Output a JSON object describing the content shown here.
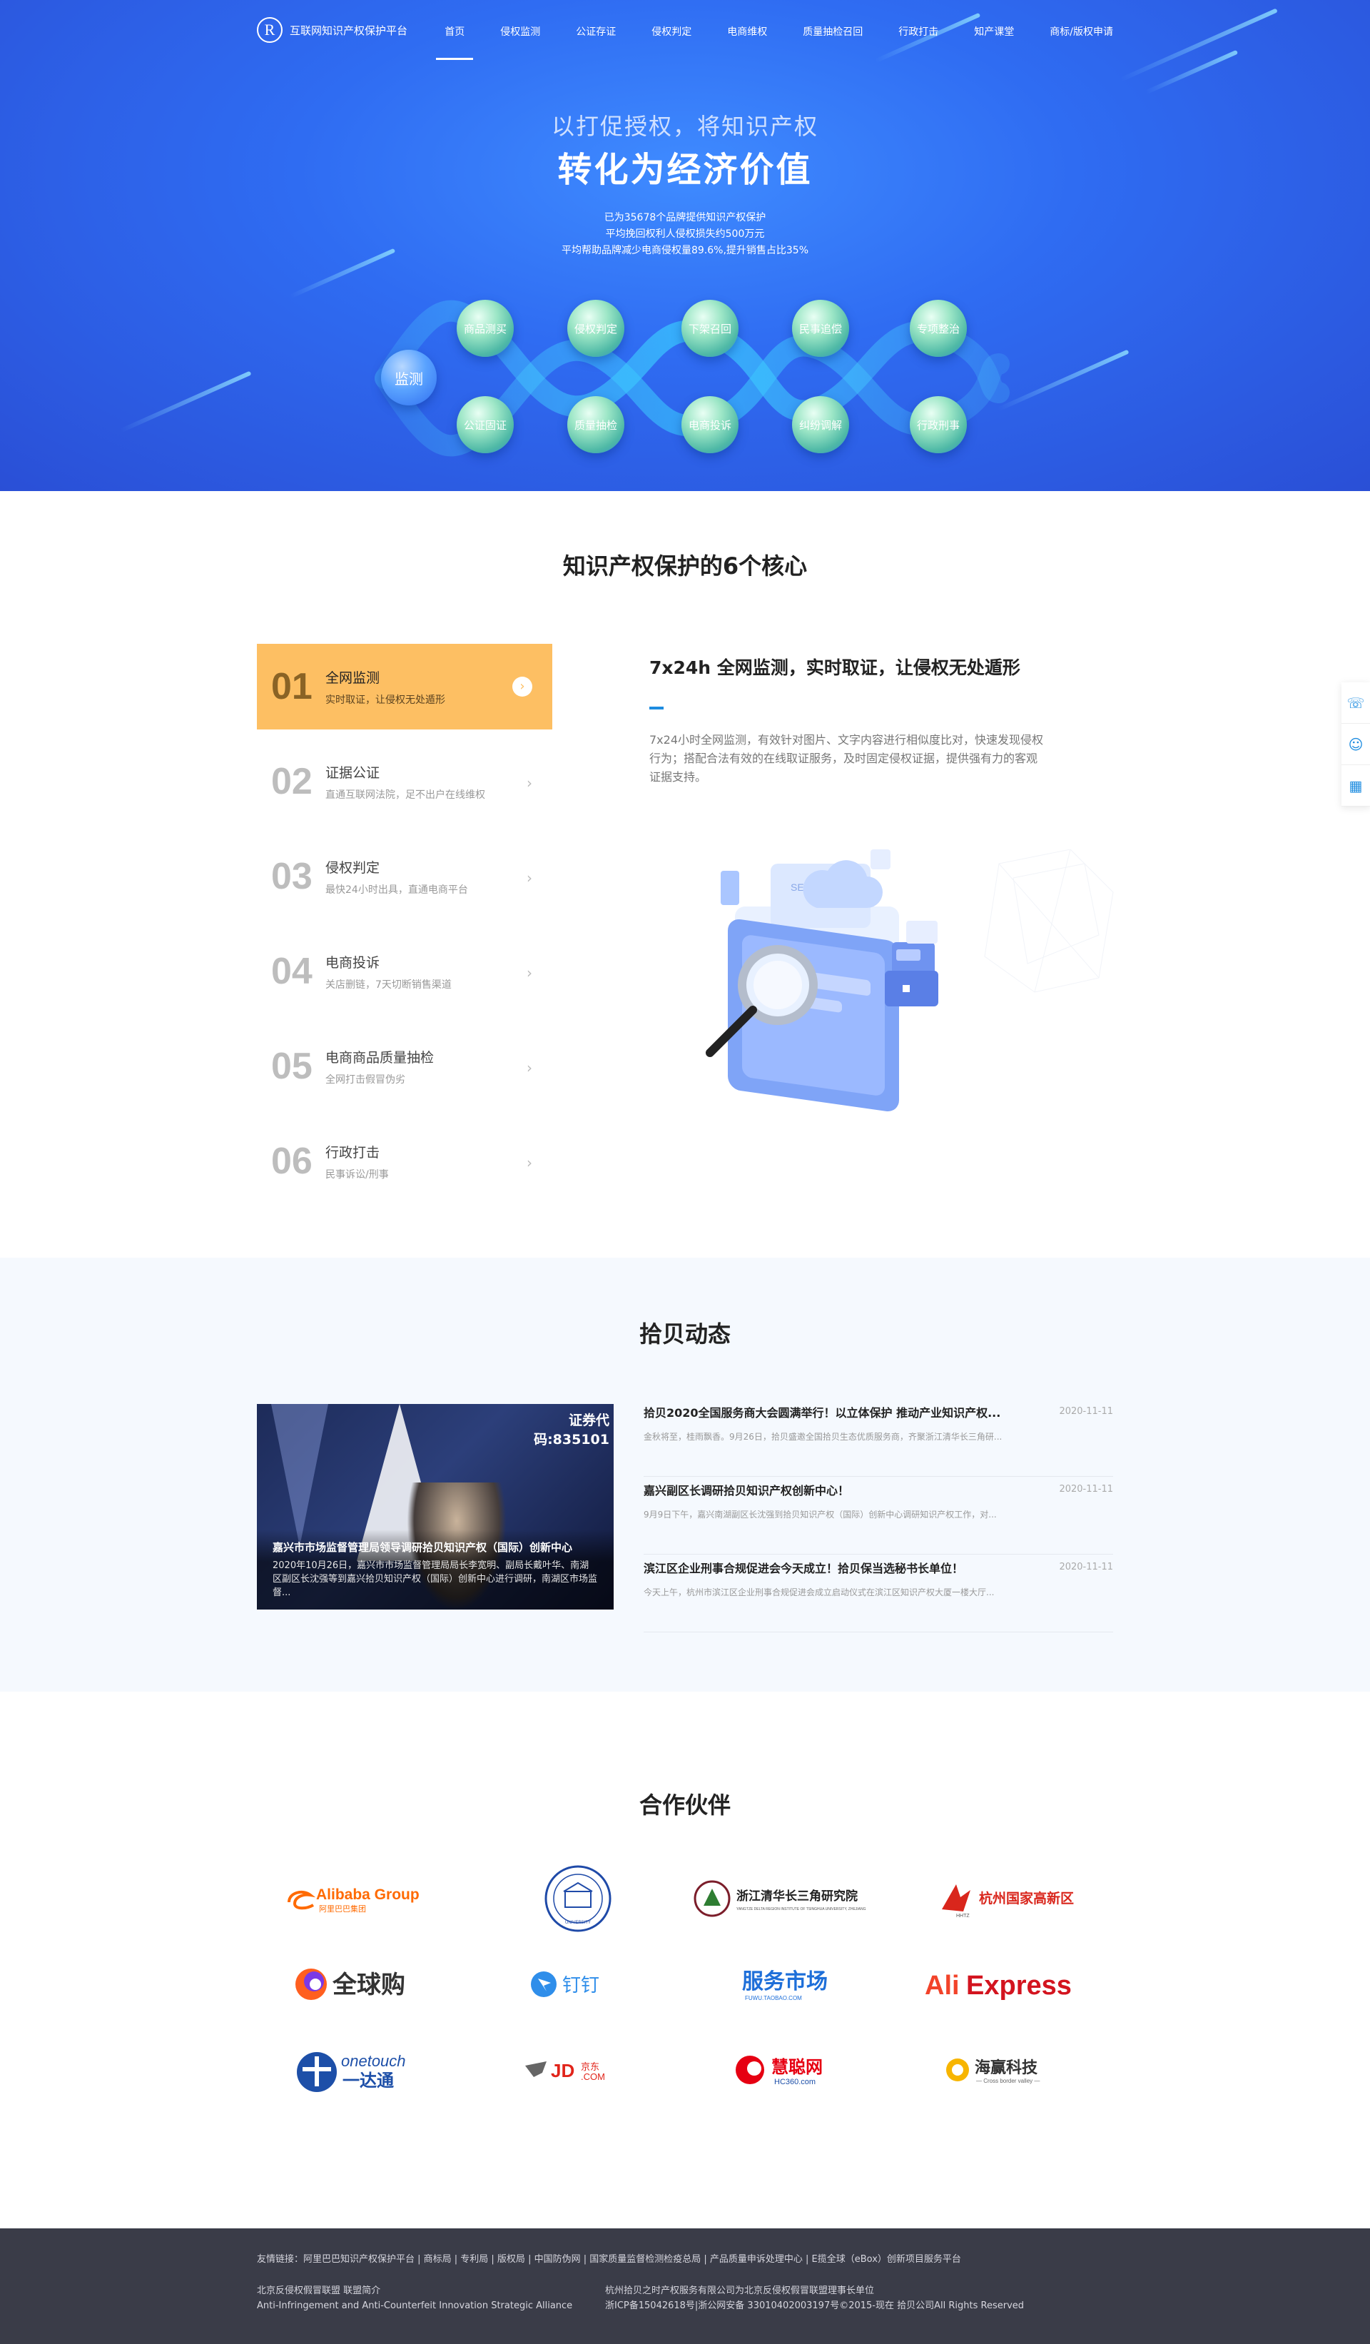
{
  "nav": {
    "logo_letter": "R",
    "logo_text": "互联网知识产权保护平台",
    "items": [
      "首页",
      "侵权监测",
      "公证存证",
      "侵权判定",
      "电商维权",
      "质量抽检召回",
      "行政打击",
      "知产课堂",
      "商标/版权申请"
    ]
  },
  "hero": {
    "subtitle": "以打促授权，将知识产权",
    "title": "转化为经济价值",
    "stats": [
      "已为35678个品牌提供知识产权保护",
      "平均挽回权利人侵权损失约500万元",
      "平均帮助品牌减少电商侵权量89.6%,提升销售占比35%"
    ],
    "center_label": "监测",
    "top_labels": [
      "商品测买",
      "侵权判定",
      "下架召回",
      "民事追偿",
      "专项整治"
    ],
    "bottom_labels": [
      "公证固证",
      "质量抽检",
      "电商投诉",
      "纠纷调解",
      "行政刑事"
    ]
  },
  "core": {
    "title": "知识产权保护的6个核心",
    "items": [
      {
        "num": "01",
        "title": "全网监测",
        "desc": "实时取证，让侵权无处遁形"
      },
      {
        "num": "02",
        "title": "证据公证",
        "desc": "直通互联网法院，足不出户在线维权"
      },
      {
        "num": "03",
        "title": "侵权判定",
        "desc": "最快24小时出具，直通电商平台"
      },
      {
        "num": "04",
        "title": "电商投诉",
        "desc": "关店删链，7天切断销售渠道"
      },
      {
        "num": "05",
        "title": "电商商品质量抽检",
        "desc": "全网打击假冒伪劣"
      },
      {
        "num": "06",
        "title": "行政打击",
        "desc": "民事诉讼/刑事"
      }
    ],
    "detail_title": "7x24h 全网监测，实时取证，让侵权无处遁形",
    "detail_text": "7x24小时全网监测，有效针对图片、文字内容进行相似度比对，快速发现侵权行为；搭配合法有效的在线取证服务，及时固定侵权证据，提供强有力的客观证据支持。",
    "illustration_label": "SEARCHING"
  },
  "news": {
    "title": "拾贝动态",
    "featured_title": "嘉兴市市场监督管理局领导调研拾贝知识产权（国际）创新中心",
    "featured_desc": "2020年10月26日，嘉兴市市场监督管理局局长李宽明、副局长戴叶华、南湖区副区长沈强等到嘉兴拾贝知识产权（国际）创新中心进行调研，南湖区市场监督...",
    "featured_bg_text": "证券代码:835101",
    "items": [
      {
        "title": "拾贝2020全国服务商大会圆满举行！以立体保护 推动产业知识产权...",
        "desc": "金秋将至，桂雨飘香。9月26日，拾贝盛邀全国拾贝生态优质服务商，齐聚浙江清华长三角研...",
        "date": "2020-11-11"
      },
      {
        "title": "嘉兴副区长调研拾贝知识产权创新中心！",
        "desc": "9月9日下午，嘉兴南湖副区长沈强到拾贝知识产权（国际）创新中心调研知识产权工作，对...",
        "date": "2020-11-11"
      },
      {
        "title": "滨江区企业刑事合规促进会今天成立！拾贝保当选秘书长单位！",
        "desc": "今天上午，杭州市滨江区企业刑事合规促进会成立启动仪式在滨江区知识产权大厦一楼大厅...",
        "date": "2020-11-11"
      }
    ]
  },
  "partners": {
    "title": "合作伙伴",
    "logos": {
      "alibaba_main": "Alibaba Group",
      "alibaba_sub": "阿里巴巴集团",
      "univ": "UNIVERSITY",
      "tsinghua": "浙江清华长三角研究院",
      "tsinghua_sub": "YANGTZE DELTA REGION INSTITUTE OF TSINGHUA UNIVERSITY, ZHEJIANG",
      "hangzhou": "杭州国家高新区",
      "hangzhou_sub": "HHTZ",
      "quanqiugou": "全球购",
      "dingding": "钉钉",
      "fuwu": "服务市场",
      "fuwu_sub": "FUWU.TAOBAO.COM",
      "aliexpress_a": "Ali",
      "aliexpress_b": "Express",
      "onetouch_a": "onetouch",
      "onetouch_b": "一达通",
      "jd_a": "JD",
      "jd_b": "京东",
      "jd_c": ".COM",
      "hc_a": "慧聪网",
      "hc_b": "HC360.com",
      "haiying_a": "海赢科技",
      "haiying_b": "— Cross border valley —"
    }
  },
  "footer": {
    "links": "友情链接：阿里巴巴知识产权保护平台 | 商标局 | 专利局 | 版权局 | 中国防伪网 | 国家质量监督检测检疫总局 | 产品质量申诉处理中心 | E揽全球（eBox）创新项目服务平台",
    "col1_line1": "北京反侵权假冒联盟 联盟简介",
    "col1_line2": "Anti-Infringement and Anti-Counterfeit Innovation Strategic Alliance",
    "col2_line1": "杭州拾贝之时产权服务有限公司为北京反侵权假冒联盟理事长单位",
    "col2_line2": "浙ICP备15042618号|浙公网安备 33010402003197号©2015-现在 拾贝公司All Rights Reserved"
  },
  "colors": {
    "accent_orange": "#fdbf63",
    "accent_blue": "#1d8ce0",
    "hero_blue": "#2f6cf2",
    "footer_bg": "#3a3c48"
  }
}
